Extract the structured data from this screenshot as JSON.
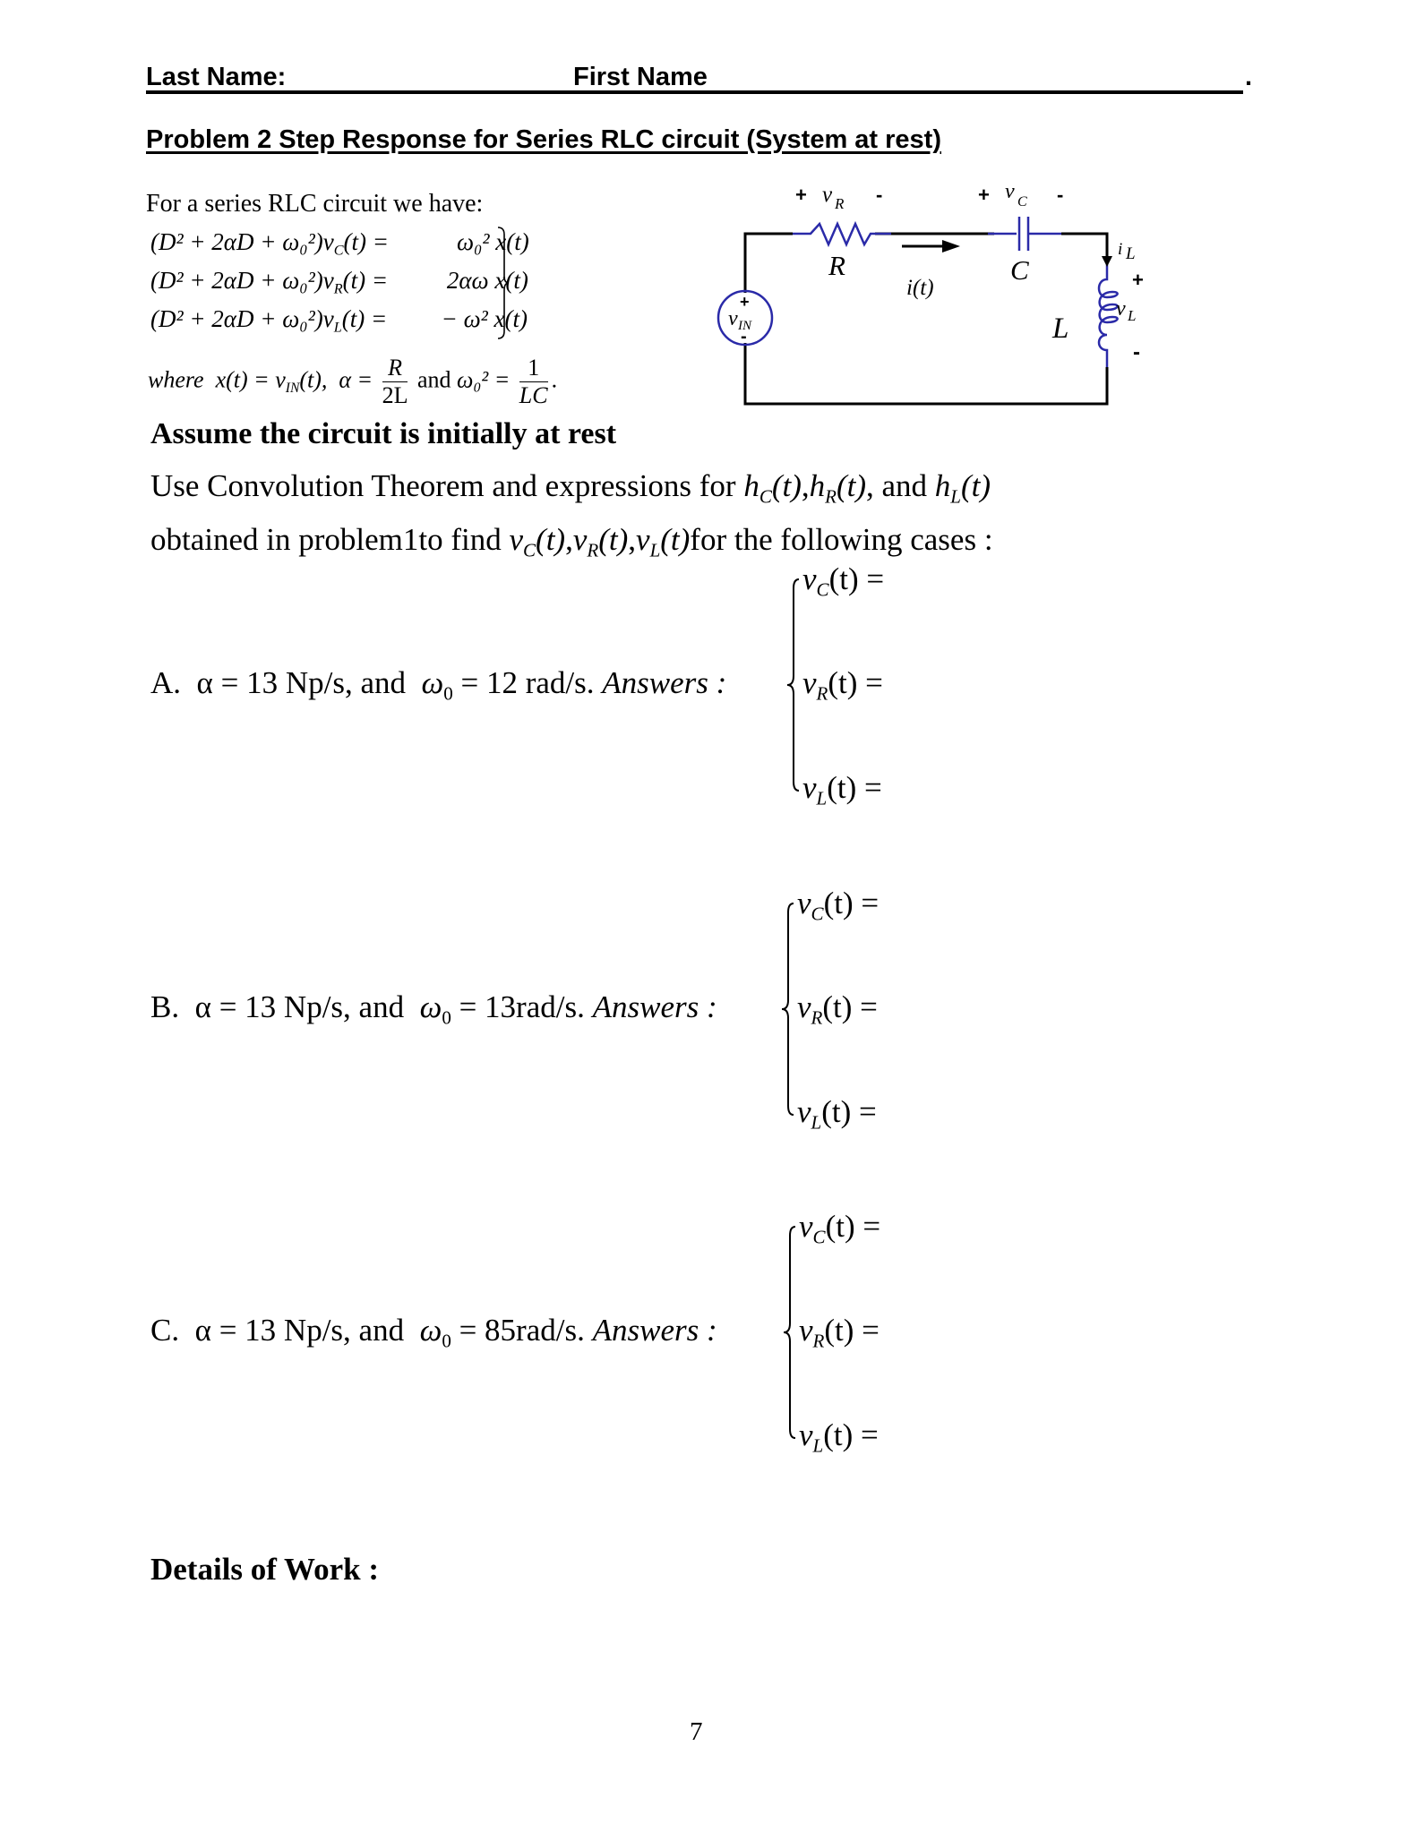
{
  "header": {
    "last_name_label": "Last Name:",
    "first_name_label": "First Name",
    "trailing_mark": "."
  },
  "title": "Problem 2 Step Response for Series RLC circuit (System at rest)",
  "intro": "For a series RLC circuit we have:",
  "equations": [
    {
      "lhs": "(D² + 2αD + ω₀²)v",
      "sub": "C",
      "mid": "(t) =",
      "rhs": "ω₀² x(t)"
    },
    {
      "lhs": "(D² + 2αD + ω₀²)v",
      "sub": "R",
      "mid": "(t) =",
      "rhs": "2αω x(t)"
    },
    {
      "lhs": "(D² + 2αD + ω₀²)v",
      "sub": "L",
      "mid": "(t) =",
      "rhs": "− ω² x(t)"
    }
  ],
  "where": {
    "prefix": "where",
    "x_def": "x(t) = v",
    "x_sub": "IN",
    "x_tail": "(t),",
    "alpha": "α =",
    "alpha_num": "R",
    "alpha_den": "2L",
    "and": "and",
    "omega": "ω₀² =",
    "omega_num": "1",
    "omega_den": "LC",
    "end": "."
  },
  "assume": "Assume the circuit is initially at rest",
  "instructions": {
    "line1_a": "Use Convolution Theorem and expressions for",
    "line1_hc": "h",
    "line1_hc_sub": "C",
    "line1_hr": "h",
    "line1_hr_sub": "R",
    "line1_and": "and",
    "line1_hl": "h",
    "line1_hl_sub": "L",
    "t_arg": "(t)",
    "line2_a": "obtained in problem1to find",
    "v": "v",
    "line2_tail": "for the following cases :"
  },
  "cases": [
    {
      "letter": "A.",
      "alpha_label": "α = 13 Np/s, and",
      "omega_label": "ω",
      "omega_sub": "0",
      "omega_value": "= 12 rad/s.",
      "answers_label": "Answers :",
      "answers": [
        {
          "var": "v",
          "sub": "C",
          "tail": "(t) ="
        },
        {
          "var": "v",
          "sub": "R",
          "tail": "(t) ="
        },
        {
          "var": "v",
          "sub": "L",
          "tail": "(t) ="
        }
      ]
    },
    {
      "letter": "B.",
      "alpha_label": "α = 13 Np/s, and",
      "omega_label": "ω",
      "omega_sub": "0",
      "omega_value": "= 13rad/s.",
      "answers_label": "Answers :",
      "answers": [
        {
          "var": "v",
          "sub": "C",
          "tail": "(t) ="
        },
        {
          "var": "v",
          "sub": "R",
          "tail": "(t) ="
        },
        {
          "var": "v",
          "sub": "L",
          "tail": "(t) ="
        }
      ]
    },
    {
      "letter": "C.",
      "alpha_label": "α = 13 Np/s, and",
      "omega_label": "ω",
      "omega_sub": "0",
      "omega_value": "= 85rad/s.",
      "answers_label": "Answers :",
      "answers": [
        {
          "var": "v",
          "sub": "C",
          "tail": "(t) ="
        },
        {
          "var": "v",
          "sub": "R",
          "tail": "(t) ="
        },
        {
          "var": "v",
          "sub": "L",
          "tail": "(t) ="
        }
      ]
    }
  ],
  "details_label": "Details of Work :",
  "page_number": "7",
  "circuit": {
    "component_color": "#2a2aa8",
    "wire_color": "#000000",
    "labels": {
      "vr_plus": "+",
      "vr": "v",
      "vr_sub": "R",
      "vr_minus": "-",
      "vc_plus": "+",
      "vc": "v",
      "vc_sub": "C",
      "vc_minus": "-",
      "resistor": "R",
      "capacitor": "C",
      "inductor": "L",
      "current": "i(t)",
      "il": "i",
      "il_sub": "L",
      "vl_plus": "+",
      "vl": "v",
      "vl_sub": "L",
      "vl_minus": "-",
      "vin": "v",
      "vin_sub": "IN",
      "vin_plus": "+",
      "vin_minus": "-"
    }
  }
}
